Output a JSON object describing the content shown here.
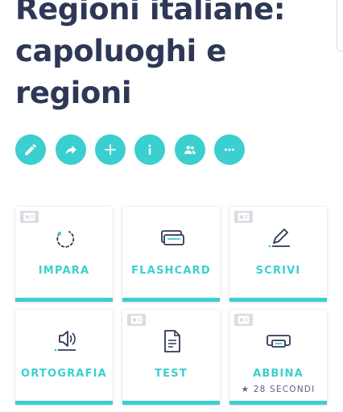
{
  "set": {
    "title": "Regioni italiane: capoluoghi e regioni"
  },
  "actions": [
    {
      "icon": "pencil-icon"
    },
    {
      "icon": "share-icon"
    },
    {
      "icon": "plus-icon"
    },
    {
      "icon": "info-icon"
    },
    {
      "icon": "people-icon"
    },
    {
      "icon": "more-icon"
    }
  ],
  "modes": [
    {
      "label": "IMPARA",
      "icon": "learn-icon",
      "badge": true
    },
    {
      "label": "FLASHCARD",
      "icon": "flashcards-icon",
      "badge": false
    },
    {
      "label": "SCRIVI",
      "icon": "write-icon",
      "badge": true
    },
    {
      "label": "ORTOGRAFIA",
      "icon": "spell-icon",
      "badge": false
    },
    {
      "label": "TEST",
      "icon": "test-icon",
      "badge": true
    },
    {
      "label": "ABBINA",
      "icon": "match-icon",
      "badge": true,
      "sub": "★ 28 SECONDI"
    }
  ],
  "colors": {
    "accent": "#3ccfcf",
    "text": "#2e3856",
    "badge": "#d9dce3"
  }
}
